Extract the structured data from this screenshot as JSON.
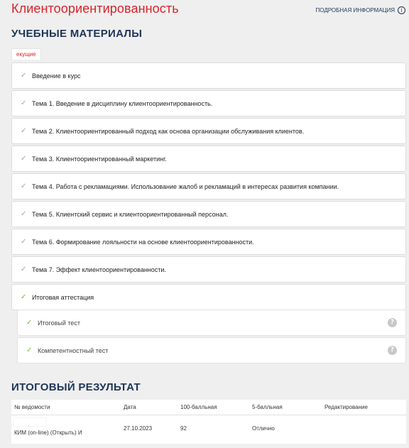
{
  "header": {
    "title": "Клиентоориентированность",
    "detail_link": "ПОДРОБНАЯ ИНФОРМАЦИЯ",
    "info_icon": "i"
  },
  "materials": {
    "heading": "УЧЕБНЫЕ МАТЕРИАЛЫ",
    "tab_badge": "екущие",
    "items": [
      {
        "label": "Введение в курс",
        "status": "completed"
      },
      {
        "label": "Тема 1. Введение в дисциплину клиентоориентированность.",
        "status": "completed"
      },
      {
        "label": "Тема 2. Клиентоориентированный подход как основа организации обслуживания клиентов.",
        "status": "completed"
      },
      {
        "label": "Тема 3. Клиентоориентированный маркетинг.",
        "status": "completed"
      },
      {
        "label": "Тема 4. Работа с рекламациями. Использование жалоб и рекламаций в интересах развития компании.",
        "status": "completed"
      },
      {
        "label": "Тема 5. Клиентский сервис и клиентоориентированный персонал.",
        "status": "completed"
      },
      {
        "label": "Тема 6. Формирование лояльности на основе клиентоориентированности.",
        "status": "completed"
      },
      {
        "label": "Тема 7. Эффект клиентоориентированности.",
        "status": "completed"
      },
      {
        "label": "Итоговая аттестация",
        "status": "passed"
      }
    ],
    "subitems": [
      {
        "label": "Итоговый тест",
        "help": "?"
      },
      {
        "label": "Компетентностный тест",
        "help": "?"
      }
    ]
  },
  "result": {
    "heading": "ИТОГОВЫЙ РЕЗУЛЬТАТ",
    "columns": [
      "№ ведомости",
      "Дата",
      "100-балльная",
      "5-балльная",
      "Редактирование"
    ],
    "rows": [
      {
        "number": "КИМ (on-line) (Открыть) И",
        "date": "27.10.2023",
        "score100": "92",
        "score5": "Отлично",
        "edit": ""
      }
    ]
  },
  "colors": {
    "title_red": "#d8232a",
    "heading_navy": "#1d3557",
    "check_gray": "#9aa5b1",
    "check_green": "#7cb342",
    "background": "#efefef"
  }
}
